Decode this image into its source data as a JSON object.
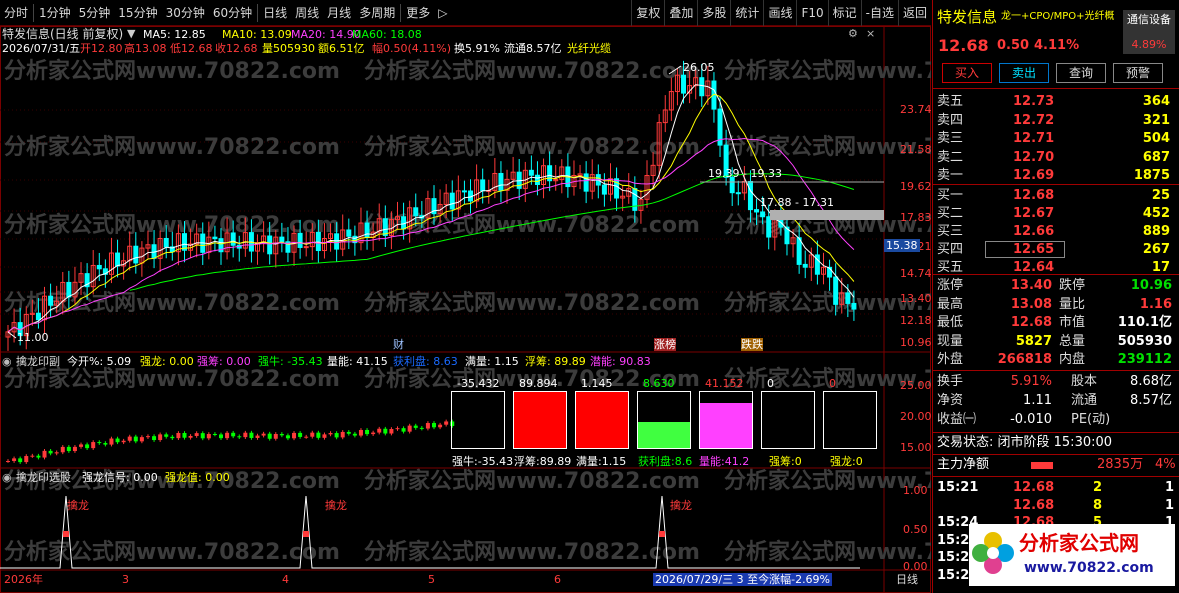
{
  "toolbar": {
    "periods": [
      "分时",
      "1分钟",
      "5分钟",
      "15分钟",
      "30分钟",
      "60分钟",
      "日线",
      "周线",
      "月线",
      "多周期",
      "更多"
    ],
    "more_arrow": "▷",
    "tools": [
      "复权",
      "叠加",
      "多股",
      "统计",
      "画线",
      "F10",
      "标记",
      "-自选",
      "返回"
    ]
  },
  "header": {
    "title_line": "特发信息(日线 前复权)",
    "ma5_label": "MA5: 12.85",
    "ma10_label": "MA10: 13.09",
    "ma20_label": "MA20: 14.90",
    "ma60_label": "MA60: 18.08",
    "date": "2026/07/31/五",
    "open": "开12.80",
    "high": "高13.08",
    "low": "低12.68",
    "close": "收12.68",
    "vol": "量505930",
    "amount": "额6.51亿",
    "amp": "幅0.50(4.11%)",
    "turnover": "换5.91%",
    "float": "流通8.57亿",
    "concept": "光纤光缆"
  },
  "main_chart": {
    "price_ticks": [
      "23.74",
      "21.58",
      "19.62",
      "17.83",
      "16.21",
      "14.74",
      "13.40",
      "12.18",
      "10.96"
    ],
    "current_price_tag": "15.38",
    "high_label": "26.05",
    "low_label": "11.00",
    "annot1": "19.39 - 19.33",
    "annot2": "17.88 - 17.31",
    "marker_cai": "财",
    "marker_zhangbang": "涨榜",
    "marker_dieti": "跌跌",
    "watermark": "分析家公式网www.70822.com"
  },
  "sub1": {
    "title": "擒龙印副",
    "items": [
      "今开%: 5.09",
      "强龙: 0.00",
      "强筹: 0.00",
      "强牛: -35.43",
      "量能: 41.15",
      "获利盘: 8.63",
      "满量: 1.15",
      "浮筹: 89.89",
      "潜能: 90.83"
    ],
    "ticks": [
      "25.00",
      "20.00",
      "15.00"
    ],
    "box_tops": [
      "-35.432",
      "89.894",
      "1.145",
      "8.630",
      "41.152",
      "0",
      "0"
    ],
    "box_bottoms": [
      "强牛:-35.43",
      "浮筹:89.89",
      "满量:1.15",
      "获利盘:8.6",
      "量能:41.2",
      "强筹:0",
      "强龙:0"
    ]
  },
  "sub2": {
    "title": "擒龙印选股",
    "items": [
      "强龙信号: 0.00",
      "强龙值: 0.00"
    ],
    "ticks": [
      "1.00",
      "0.50",
      "0.00"
    ],
    "signal_label": "擒龙"
  },
  "axis": {
    "labels": [
      "2026年",
      "3",
      "4",
      "5",
      "6"
    ],
    "cursor_info": "2026/07/29/三 3 至今涨幅-2.69%",
    "period": "日线"
  },
  "right_panel": {
    "name": "特发信息",
    "tags": "龙一+CPO/MPO+光纤概",
    "device": "通信设备",
    "device_pct": "4.89%",
    "price": "12.68",
    "change": "0.50",
    "pct": "4.11%",
    "buttons": [
      "买入",
      "卖出",
      "查询",
      "预警"
    ],
    "asks": [
      [
        "卖五",
        "12.73",
        "364"
      ],
      [
        "卖四",
        "12.72",
        "321"
      ],
      [
        "卖三",
        "12.71",
        "504"
      ],
      [
        "卖二",
        "12.70",
        "687"
      ],
      [
        "卖一",
        "12.69",
        "1875"
      ]
    ],
    "bids": [
      [
        "买一",
        "12.68",
        "25"
      ],
      [
        "买二",
        "12.67",
        "452"
      ],
      [
        "买三",
        "12.66",
        "889"
      ],
      [
        "买四",
        "12.65",
        "267"
      ],
      [
        "买五",
        "12.64",
        "17"
      ]
    ],
    "stats": [
      [
        "涨停",
        "13.40",
        "跌停",
        "10.96"
      ],
      [
        "最高",
        "13.08",
        "量比",
        "1.16"
      ],
      [
        "最低",
        "12.68",
        "市值",
        "110.1亿"
      ],
      [
        "现量",
        "5827",
        "总量",
        "505930"
      ],
      [
        "外盘",
        "266818",
        "内盘",
        "239112"
      ]
    ],
    "stats2": [
      [
        "换手",
        "5.91%",
        "股本",
        "8.68亿"
      ],
      [
        "净资",
        "1.11",
        "流通",
        "8.57亿"
      ],
      [
        "收益㈠",
        "-0.010",
        "PE(动)",
        ""
      ]
    ],
    "trade_state": "交易状态: 闭市阶段 15:30:00",
    "main_net_label": "主力净额",
    "main_net_value": "2835万",
    "main_net_pct": "4%",
    "ticks": [
      [
        "15:21",
        "12.68",
        "2",
        "1"
      ],
      [
        "",
        "12.68",
        "8",
        "1"
      ],
      [
        "15:24",
        "12.68",
        "5",
        "1"
      ],
      [
        "15:2",
        "",
        "",
        ""
      ],
      [
        "15:2",
        "",
        "",
        ""
      ],
      [
        "15:2",
        "",
        "",
        ""
      ]
    ],
    "logo_title": "分析家公式网",
    "logo_url": "www.70822.com"
  },
  "colors": {
    "up": "#ff3a3a",
    "down": "#00ffff",
    "ma5": "#ffffff",
    "ma10": "#ffff00",
    "ma20": "#ff40ff",
    "ma60": "#00ff00",
    "border": "#a00000"
  }
}
